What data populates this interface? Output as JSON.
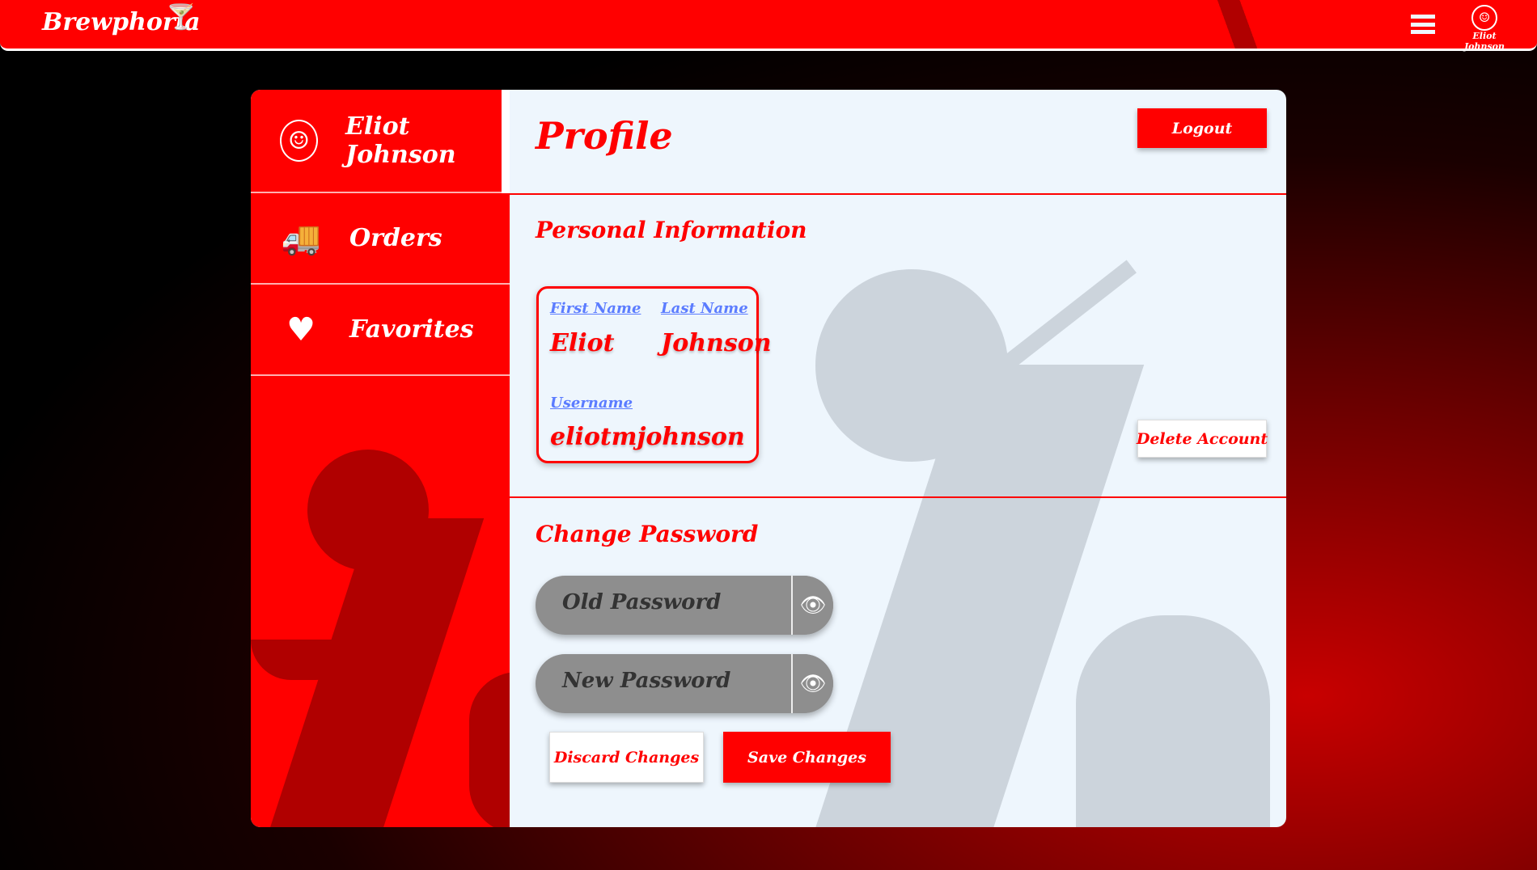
{
  "header": {
    "logo": "Brewphoria",
    "user_name": "Eliot Johnson"
  },
  "sidebar": {
    "items": [
      {
        "label": "Eliot Johnson",
        "icon": "user-avatar-icon"
      },
      {
        "label": "Orders",
        "icon": "truck-icon"
      },
      {
        "label": "Favorites",
        "icon": "heart-icon"
      }
    ]
  },
  "main": {
    "title": "Profile",
    "logout": "Logout",
    "personal": {
      "heading": "Personal Information",
      "first_label": "First Name",
      "first_value": "Eliot",
      "last_label": "Last Name",
      "last_value": "Johnson",
      "username_label": "Username",
      "username_value": "eliotmjohnson",
      "delete": "Delete Account"
    },
    "password": {
      "heading": "Change Password",
      "old_placeholder": "Old Password",
      "new_placeholder": "New Password",
      "discard": "Discard Changes",
      "save": "Save Changes"
    }
  },
  "colors": {
    "accent": "#ff0000",
    "panel": "#eef6fd",
    "label": "#5b7cff"
  }
}
